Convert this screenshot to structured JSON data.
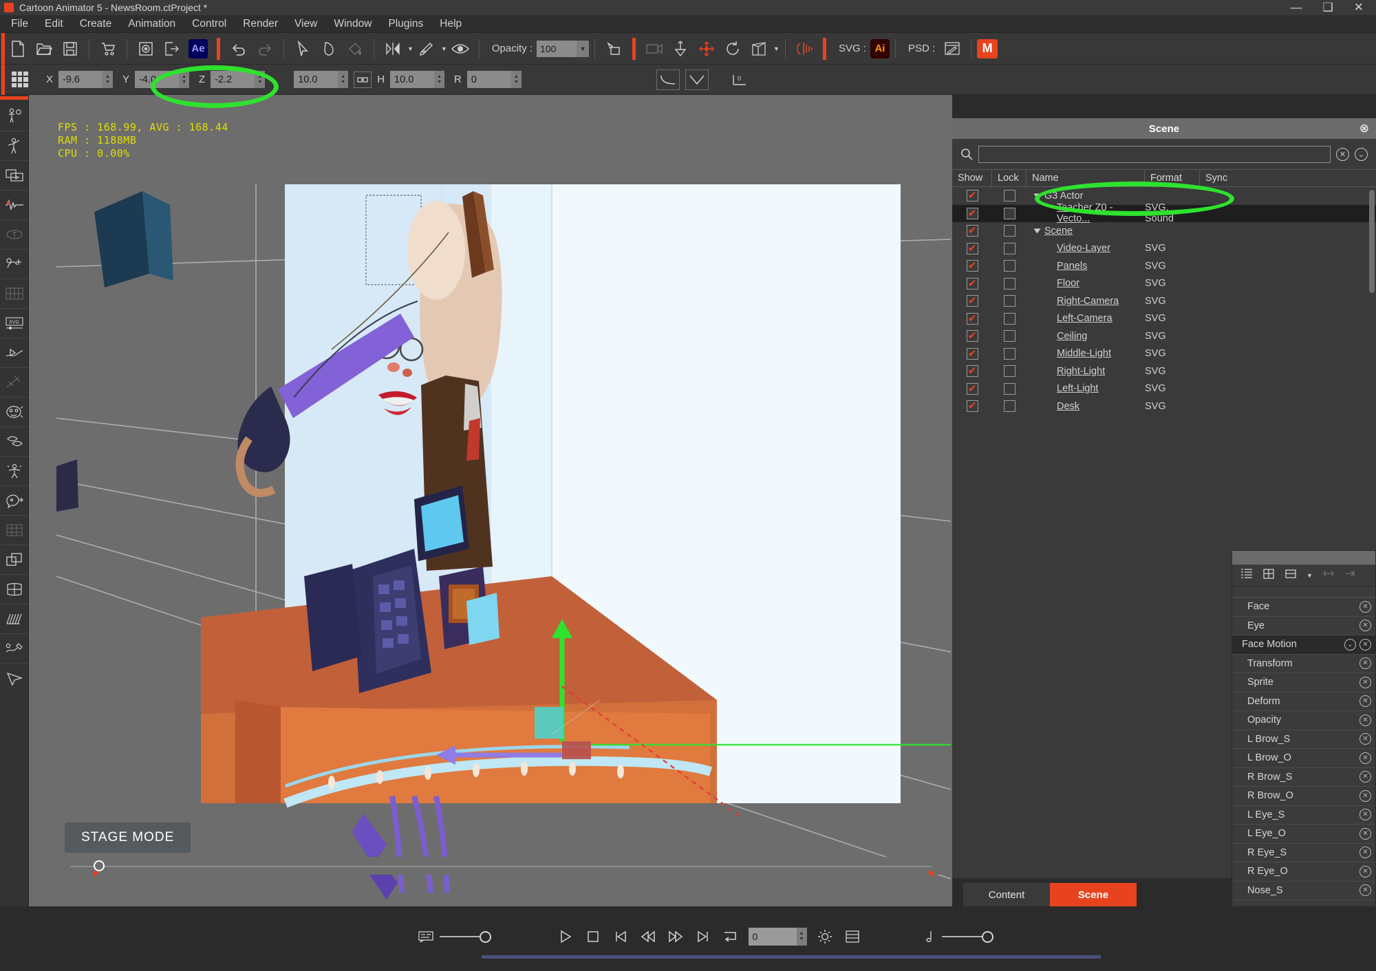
{
  "window": {
    "title": "Cartoon Animator 5 - NewsRoom.ctProject *",
    "minimize": "—",
    "maximize": "❑",
    "close": "✕"
  },
  "menubar": [
    "File",
    "Edit",
    "Create",
    "Animation",
    "Control",
    "Render",
    "View",
    "Window",
    "Plugins",
    "Help"
  ],
  "toolbar": {
    "ae_label": "Ae",
    "opacity_label": "Opacity :",
    "opacity_value": "100",
    "svg_label": "SVG :",
    "ai_label": "Ai",
    "psd_label": "PSD :",
    "m_label": "M",
    "icons": [
      "new-document",
      "open-folder",
      "save",
      "content-store",
      "render-preview",
      "export",
      "after-effects",
      "undo",
      "redo",
      "select-arrow",
      "clone",
      "paint-bucket",
      "mirror",
      "pen-tool",
      "visibility-eye",
      "transform-tool",
      "camera",
      "pivot",
      "move",
      "rotate",
      "perspective",
      "audio-waveform"
    ]
  },
  "transform": {
    "x_label": "X",
    "x_value": "-9.6",
    "y_label": "Y",
    "y_value": "-4.0",
    "z_label": "Z",
    "z_value": "-2.2",
    "w_value": "10.0",
    "h_label": "H",
    "h_value": "10.0",
    "r_label": "R",
    "r_value": "0"
  },
  "stage": {
    "fps_text": "FPS : 168.99, AVG : 168.44\nRAM : 1188MB\nCPU : 0.00%",
    "mode_badge": "STAGE MODE"
  },
  "scene_panel": {
    "title": "Scene",
    "search_placeholder": "",
    "search_value": "",
    "columns": [
      "Show",
      "Lock",
      "Name",
      "Format",
      "Sync"
    ],
    "rows": [
      {
        "name": "G3 Actor",
        "format": "",
        "indent": 0,
        "group": true,
        "selected": false,
        "show": true,
        "lock": false,
        "underline": false
      },
      {
        "name": "Teacher Z0 - Vecto...",
        "format": "SVG, Sound",
        "indent": 2,
        "group": false,
        "selected": true,
        "show": true,
        "lock": false,
        "underline": true
      },
      {
        "name": "Scene",
        "format": "",
        "indent": 0,
        "group": true,
        "selected": false,
        "show": true,
        "lock": false,
        "underline": true
      },
      {
        "name": "Video-Layer",
        "format": "SVG",
        "indent": 2,
        "group": false,
        "selected": false,
        "show": true,
        "lock": false,
        "underline": true
      },
      {
        "name": "Panels",
        "format": "SVG",
        "indent": 2,
        "group": false,
        "selected": false,
        "show": true,
        "lock": false,
        "underline": true
      },
      {
        "name": "Floor",
        "format": "SVG",
        "indent": 2,
        "group": false,
        "selected": false,
        "show": true,
        "lock": false,
        "underline": true
      },
      {
        "name": "Right-Camera",
        "format": "SVG",
        "indent": 2,
        "group": false,
        "selected": false,
        "show": true,
        "lock": false,
        "underline": true
      },
      {
        "name": "Left-Camera",
        "format": "SVG",
        "indent": 2,
        "group": false,
        "selected": false,
        "show": true,
        "lock": false,
        "underline": true
      },
      {
        "name": "Ceiling",
        "format": "SVG",
        "indent": 2,
        "group": false,
        "selected": false,
        "show": true,
        "lock": false,
        "underline": true
      },
      {
        "name": "Middle-Light",
        "format": "SVG",
        "indent": 2,
        "group": false,
        "selected": false,
        "show": true,
        "lock": false,
        "underline": true
      },
      {
        "name": "Right-Light",
        "format": "SVG",
        "indent": 2,
        "group": false,
        "selected": false,
        "show": true,
        "lock": false,
        "underline": true
      },
      {
        "name": "Left-Light",
        "format": "SVG",
        "indent": 2,
        "group": false,
        "selected": false,
        "show": true,
        "lock": false,
        "underline": true
      },
      {
        "name": "Desk",
        "format": "SVG",
        "indent": 2,
        "group": false,
        "selected": false,
        "show": true,
        "lock": false,
        "underline": true
      }
    ]
  },
  "dock_tabs": [
    {
      "label": "Content",
      "active": false
    },
    {
      "label": "Scene",
      "active": true
    }
  ],
  "timeline_panel": {
    "tracks": [
      {
        "label": "Face",
        "selected": false,
        "has_expand": false
      },
      {
        "label": "Eye",
        "selected": false,
        "has_expand": false
      },
      {
        "label": "Face Motion",
        "selected": true,
        "has_expand": true
      },
      {
        "label": "Transform",
        "selected": false,
        "has_expand": false
      },
      {
        "label": "Sprite",
        "selected": false,
        "has_expand": false
      },
      {
        "label": "Deform",
        "selected": false,
        "has_expand": false
      },
      {
        "label": "Opacity",
        "selected": false,
        "has_expand": false
      },
      {
        "label": "L Brow_S",
        "selected": false,
        "has_expand": false
      },
      {
        "label": "L Brow_O",
        "selected": false,
        "has_expand": false
      },
      {
        "label": "R Brow_S",
        "selected": false,
        "has_expand": false
      },
      {
        "label": "R Brow_O",
        "selected": false,
        "has_expand": false
      },
      {
        "label": "L Eye_S",
        "selected": false,
        "has_expand": false
      },
      {
        "label": "L Eye_O",
        "selected": false,
        "has_expand": false
      },
      {
        "label": "R Eye_S",
        "selected": false,
        "has_expand": false
      },
      {
        "label": "R Eye_O",
        "selected": false,
        "has_expand": false
      },
      {
        "label": "Nose_S",
        "selected": false,
        "has_expand": false
      }
    ]
  },
  "transport": {
    "frame_value": "0",
    "buttons": [
      "play",
      "stop",
      "first-frame",
      "previous-frame",
      "next-frame",
      "last-frame",
      "loop",
      "render-settings",
      "track-list"
    ]
  },
  "colors": {
    "accent_orange": "#e8431f",
    "highlight_green": "#2ee22e",
    "panel_bg": "#3a3a3a",
    "toolbar_bg": "#383838",
    "stage_bg": "#6d6d6d",
    "fps_yellow": "#dede00"
  }
}
